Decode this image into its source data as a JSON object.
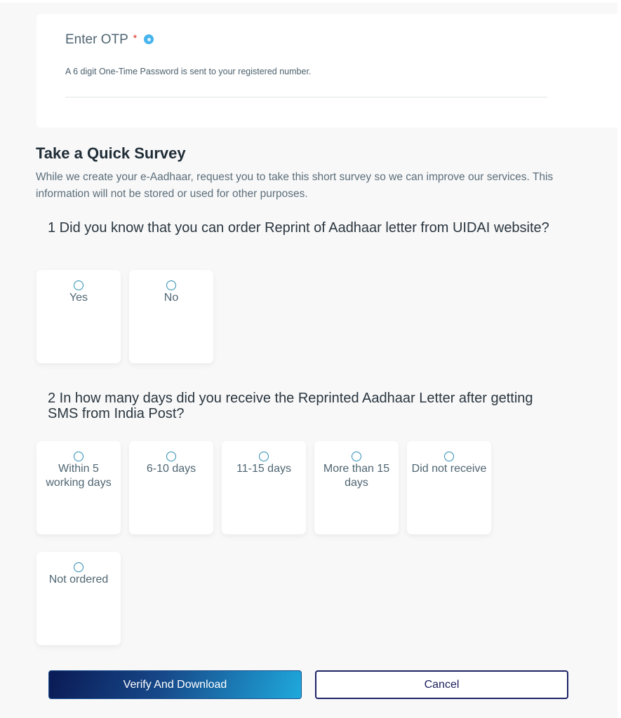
{
  "otp": {
    "label": "Enter OTP",
    "required_marker": "*",
    "info_icon": "info-icon",
    "help_text": "A 6 digit One-Time Password is sent to your registered number.",
    "value": "",
    "placeholder": ""
  },
  "survey": {
    "title": "Take a Quick Survey",
    "description": "While we create your e-Aadhaar, request you to take this short survey so we can improve our services. This information will not be stored or used for other purposes.",
    "questions": [
      {
        "text": "1 Did you know that you can order Reprint of Aadhaar letter from UIDAI website?",
        "options": [
          {
            "label": "Yes",
            "selected": false
          },
          {
            "label": "No",
            "selected": false
          }
        ]
      },
      {
        "text": "2 In how many days did you receive the Reprinted Aadhaar Letter after getting SMS from India Post?",
        "options": [
          {
            "label": "Within 5 working days",
            "selected": false
          },
          {
            "label": "6-10 days",
            "selected": false
          },
          {
            "label": "11-15 days",
            "selected": false
          },
          {
            "label": "More than 15 days",
            "selected": false
          },
          {
            "label": "Did not receive",
            "selected": false
          },
          {
            "label": "Not ordered",
            "selected": false
          }
        ]
      }
    ]
  },
  "actions": {
    "verify_label": "Verify And Download",
    "cancel_label": "Cancel"
  },
  "colors": {
    "required": "#e2231a",
    "info": "#47b4ee",
    "radio_border": "#2c8db3",
    "primary_gradient_start": "#0a1a55",
    "primary_gradient_end": "#1fa9dc",
    "cancel_border": "#1d2366"
  }
}
